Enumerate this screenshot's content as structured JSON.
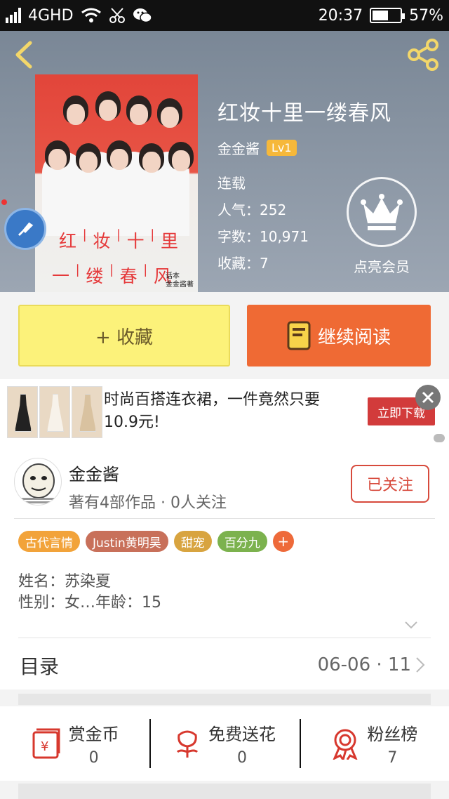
{
  "status_bar": {
    "network": "4GHD",
    "time": "20:37",
    "battery_percent": "57%",
    "battery_level": 0.57
  },
  "book": {
    "title": "红妆十里一缕春风",
    "author": "金金酱",
    "level": "Lv1",
    "status": "连载",
    "popularity": "人气：252",
    "word_count": "字数：10,971",
    "favorites": "收藏：7",
    "vip_label": "点亮会员",
    "cover": {
      "title_line1": [
        "红",
        "妆",
        "十",
        "里"
      ],
      "title_line2": [
        "一",
        "缕",
        "春",
        "风"
      ],
      "meta_line1": "话本",
      "meta_line2": "金金酱著"
    }
  },
  "actions": {
    "collect_label": "+ 收藏",
    "read_label": "继续阅读"
  },
  "ad": {
    "text": "时尚百搭连衣裙，一件竟然只要10.9元!",
    "cta": "立即下载"
  },
  "author_card": {
    "name": "金金酱",
    "subtitle": "著有4部作品 · 0人关注",
    "follow_label": "已关注",
    "tags": [
      {
        "label": "古代言情",
        "color": "#f2a33a"
      },
      {
        "label": "Justin黄明昊",
        "color": "#c8705a"
      },
      {
        "label": "甜宠",
        "color": "#d8a440"
      },
      {
        "label": "百分九",
        "color": "#7cb24e"
      }
    ],
    "tag_more": "+",
    "bio_line1": "姓名：苏染夏",
    "bio_line2": "性别：女…年龄：15",
    "toc_label": "目录",
    "toc_update": "06-06 · 11"
  },
  "bottom_stats": [
    {
      "label": "赏金币",
      "value": "0",
      "icon": "red-envelope-icon"
    },
    {
      "label": "免费送花",
      "value": "0",
      "icon": "flower-icon"
    },
    {
      "label": "粉丝榜",
      "value": "7",
      "icon": "medal-icon"
    }
  ],
  "colors": {
    "accent_orange": "#ef6a34",
    "collect_yellow": "#fcf27a",
    "follow_red": "#d74a3c",
    "level_badge": "#f6b83a"
  }
}
